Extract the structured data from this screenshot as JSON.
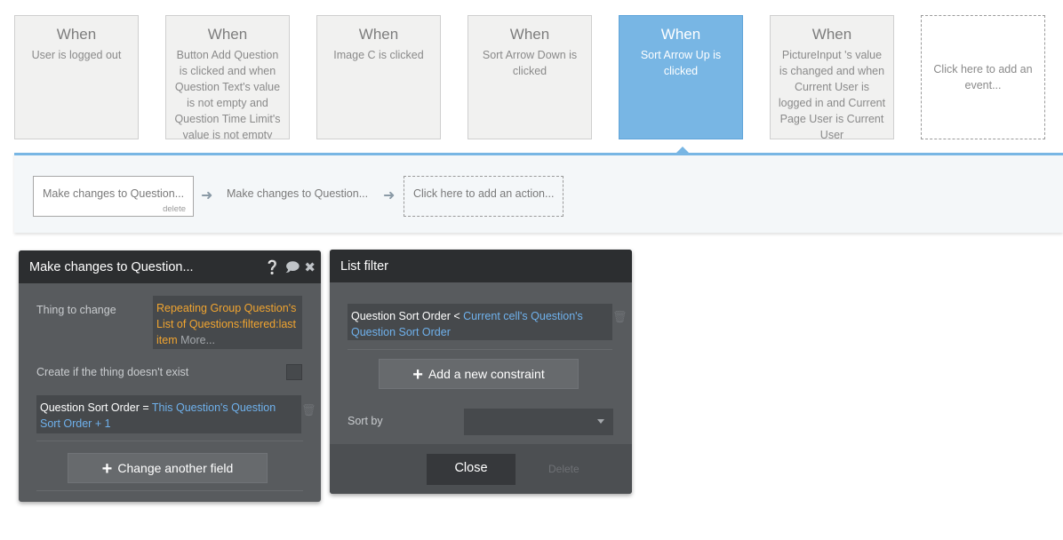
{
  "events": [
    {
      "when": "When",
      "desc": "User is logged out"
    },
    {
      "when": "When",
      "desc": "Button Add Question is clicked and when Question Text's value is not empty and Question Time Limit's value is not empty"
    },
    {
      "when": "When",
      "desc": "Image C is clicked"
    },
    {
      "when": "When",
      "desc": "Sort Arrow Down is clicked"
    },
    {
      "when": "When",
      "desc": "Sort Arrow Up is clicked"
    },
    {
      "when": "When",
      "desc": "PictureInput 's value is changed and when Current User is logged in and Current Page User is Current User"
    }
  ],
  "add_event_label": "Click here to add an event...",
  "actions": {
    "action1": "Make changes to Question...",
    "action1_delete": "delete",
    "action2": "Make changes to Question...",
    "add_action": "Click here to add an action..."
  },
  "editor_panel": {
    "title": "Make changes to Question...",
    "thing_label": "Thing to change",
    "thing_value": "Repeating Group Question's List of Questions:filtered:last item",
    "thing_more": "More...",
    "create_label": "Create if the thing doesn't exist",
    "field_name": "Question Sort Order",
    "field_op": "=",
    "field_value": "This Question's Question Sort Order + 1",
    "change_field_button": "Change another field"
  },
  "filter_panel": {
    "title": "List filter",
    "constraint_field": "Question Sort Order <",
    "constraint_value": "Current cell's Question's Question Sort Order",
    "add_constraint_button": "Add a new constraint",
    "sort_label": "Sort by",
    "sort_value": "",
    "close_button": "Close",
    "delete_button": "Delete"
  },
  "colors": {
    "accent": "#78b6e4",
    "panel_bg": "#585b5e",
    "header_bg": "#2c2e30",
    "orange_text": "#f0a430",
    "blue_text": "#6fb1ec"
  },
  "icons": {
    "help": "question-circle-icon",
    "comment": "speech-bubble-icon",
    "close": "close-icon",
    "trash": "trash-icon",
    "arrow": "arrow-right-icon",
    "plus": "plus-icon",
    "dropdown": "chevron-down-icon"
  }
}
